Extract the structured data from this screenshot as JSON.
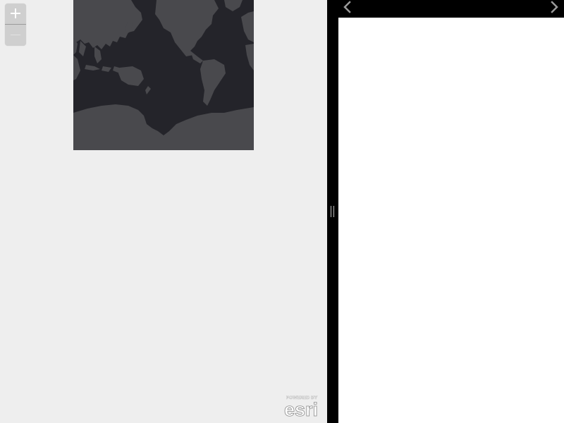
{
  "map": {
    "theme_colors": {
      "pane_background": "#eeeeee",
      "ocean": "#24242a",
      "land": "#49494d",
      "zoom_control": "#cfcfcf",
      "zoom_glyph": "#ffffff"
    },
    "zoom_in_icon": "plus-icon",
    "zoom_out_icon": "minus-icon",
    "attribution": {
      "powered_by": "POWERED BY",
      "brand": "esri"
    }
  },
  "splitter": {
    "grip_icon": "drag-handle-icon"
  },
  "story_nav": {
    "prev_icon": "chevron-left-icon",
    "next_icon": "chevron-right-icon",
    "header_color": "#000000",
    "arrow_color": "#9a9a9a"
  },
  "content_panel": {
    "background": "#ffffff"
  }
}
